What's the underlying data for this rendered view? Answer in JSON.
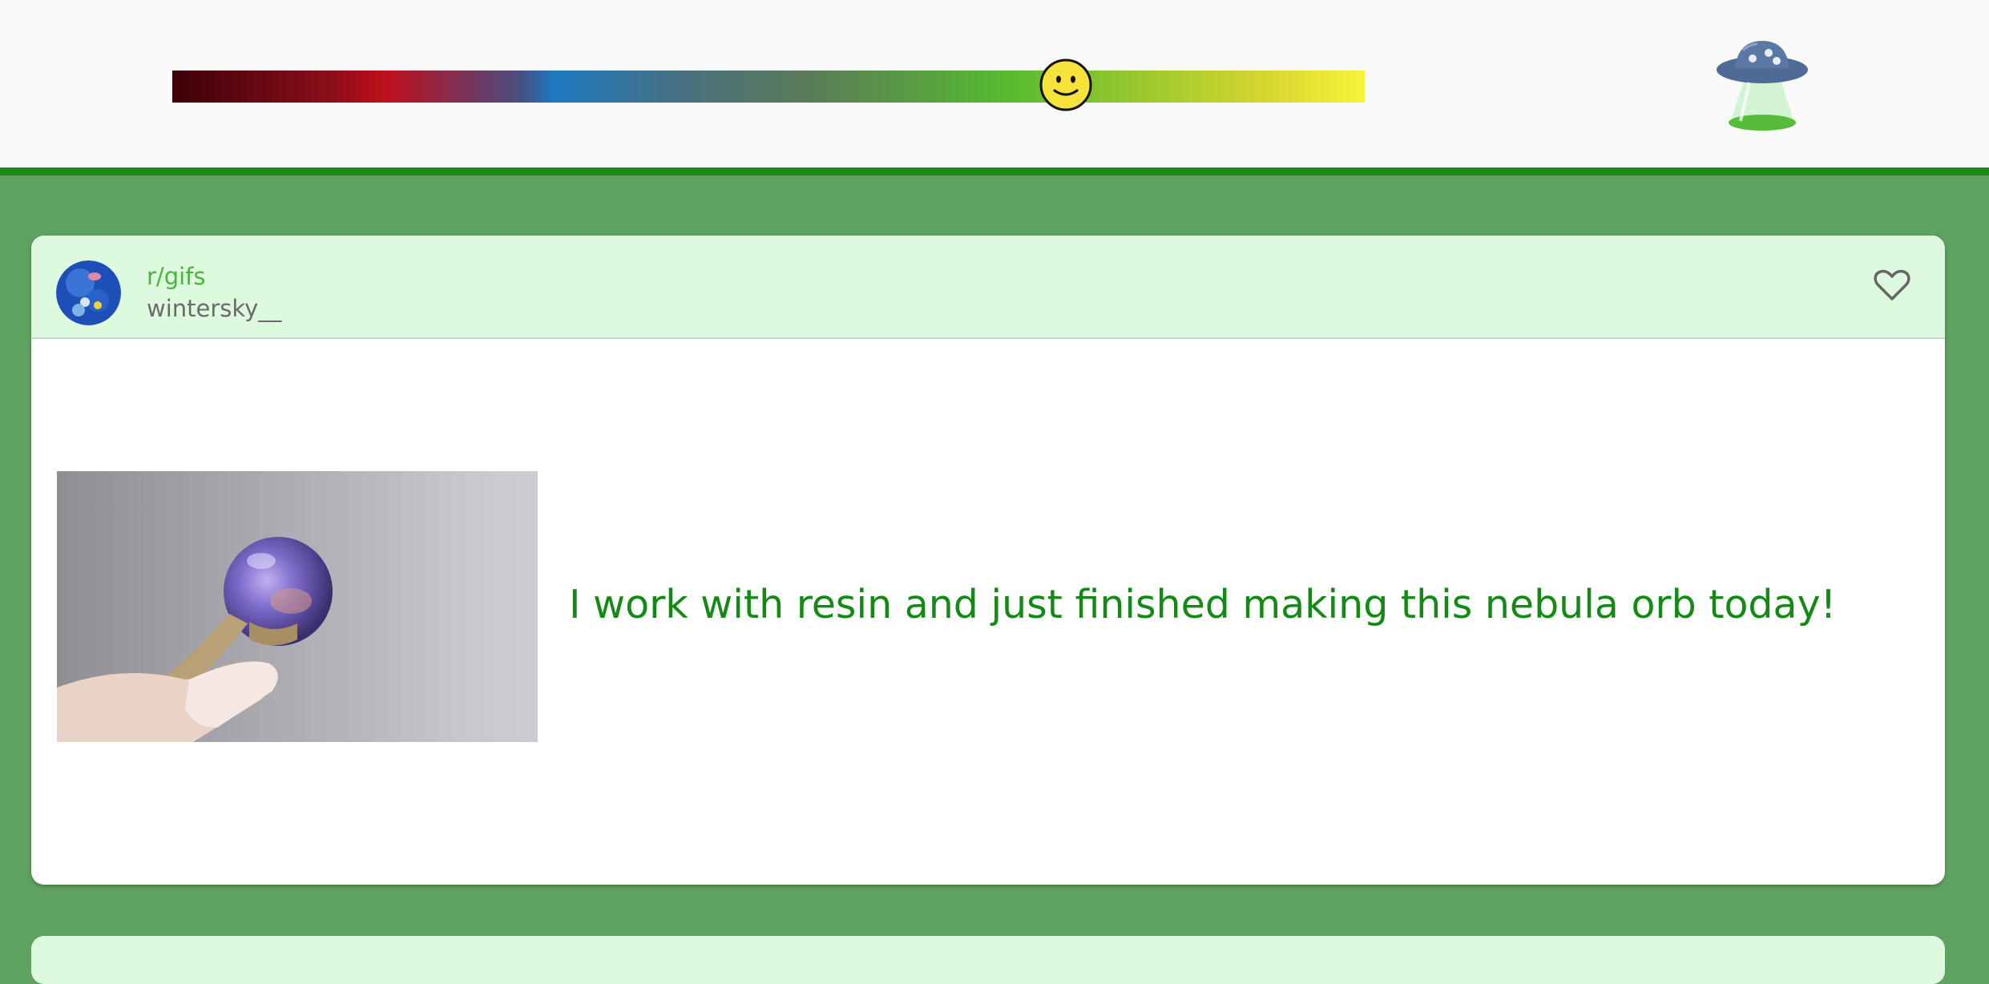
{
  "header": {
    "mood_slider": {
      "value": 0.75,
      "knob_icon": "smiley-face-icon"
    },
    "logo_icon": "ufo-icon"
  },
  "posts": [
    {
      "subreddit": "r/gifs",
      "author": "wintersky__",
      "title": "I work with resin and just finished making this nebula orb today!",
      "favorite_icon": "heart-outline-icon"
    }
  ],
  "colors": {
    "header_border": "#1e8a1e",
    "page_background": "#5fa161",
    "card_header_background": "#ddfadf",
    "subreddit_text": "#4cb33c",
    "title_text": "#138a13"
  }
}
